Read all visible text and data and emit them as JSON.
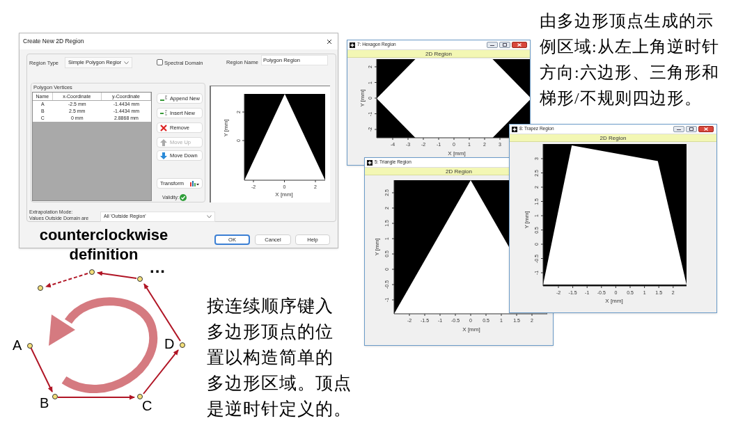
{
  "dialog": {
    "title": "Create New 2D Region",
    "region_type": {
      "label": "Region Type",
      "value": "Simple Polygon Regior"
    },
    "spectral_domain": {
      "label": "Spectral Domain",
      "checked": false
    },
    "region_name": {
      "label": "Region Name",
      "value": "Polygon Region"
    },
    "vertices": {
      "title": "Polygon Vertices",
      "columns": [
        "Name",
        "x-Coordinate",
        "y-Coordinate"
      ],
      "rows": [
        [
          "A",
          "-2.5 mm",
          "-1.4434 mm"
        ],
        [
          "B",
          "2.5 mm",
          "-1.4434 mm"
        ],
        [
          "C",
          "0 mm",
          "2.8868 mm"
        ]
      ]
    },
    "buttons": [
      {
        "label": "Append New",
        "kind": "append",
        "disabled": false
      },
      {
        "label": "Insert New",
        "kind": "insert",
        "disabled": false
      },
      {
        "label": "Remove",
        "kind": "remove",
        "disabled": false
      },
      {
        "label": "Move Up",
        "kind": "up",
        "disabled": true
      },
      {
        "label": "Move Down",
        "kind": "down",
        "disabled": false
      }
    ],
    "transform": {
      "label": "Transform"
    },
    "validity": {
      "label": "Validity:",
      "valid": true
    },
    "preview": {
      "xlabel": "X [mm]",
      "ylabel": "Y [mm]",
      "xticks": [
        "-2",
        "0",
        "2"
      ],
      "yticks": [
        "2",
        "0"
      ]
    },
    "extrapolation": {
      "label": [
        "Extrapolation Mode:",
        "Values Outside Domain are"
      ],
      "value": "All 'Outside Region'"
    },
    "footer_buttons": [
      {
        "label": "OK",
        "focused": true
      },
      {
        "label": "Cancel",
        "focused": false
      },
      {
        "label": "Help",
        "focused": false
      }
    ]
  },
  "caption": [
    "counterclockwise",
    "definition"
  ],
  "diagram": {
    "labels": [
      "A",
      "B",
      "C",
      "D"
    ],
    "ellipsis": "..."
  },
  "note_top": [
    "由多边形顶点生成的示",
    "例区域:从左上角逆时针",
    "方向:六边形、三角形和",
    "梯形/不规则四边形。"
  ],
  "note_bottom": [
    "按连续顺序键入",
    "多边形顶点的位",
    "置以构造简单的",
    "多边形区域。顶点",
    "是逆时针定义的。"
  ],
  "windows": [
    {
      "kind": "hexagon",
      "title": "7: Hexagon Region",
      "header": "2D Region",
      "xlabel": "X [mm]",
      "ylabel": "Y [mm]",
      "xticks": [
        "-4",
        "-3",
        "-2",
        "-1",
        "0",
        "1",
        "2",
        "3"
      ],
      "yticks": [
        "2",
        "1",
        "0",
        "-1",
        "-2"
      ]
    },
    {
      "kind": "triangle",
      "title": "5: Triangle Region",
      "header": "2D Region",
      "xlabel": "X [mm]",
      "ylabel": "Y [mm]",
      "xticks": [
        "-2",
        "-1.5",
        "-1",
        "-0.5",
        "0",
        "0.5",
        "1",
        "1.5",
        "2"
      ],
      "yticks": [
        "2.5",
        "2",
        "1.5",
        "1",
        "0.5",
        "0",
        "-0.5",
        "-1"
      ]
    },
    {
      "kind": "trapez",
      "title": "8: Trapez Region",
      "header": "2D Region",
      "xlabel": "X [mm]",
      "ylabel": "Y [mm]",
      "xticks": [
        "-2",
        "-1.5",
        "-1",
        "-0.5",
        "0",
        "0.5",
        "1",
        "1.5",
        "2"
      ],
      "yticks": [
        "3",
        "2.5",
        "2",
        "1.5",
        "1",
        "0.5",
        "0",
        "-0.5",
        "-1"
      ]
    }
  ]
}
